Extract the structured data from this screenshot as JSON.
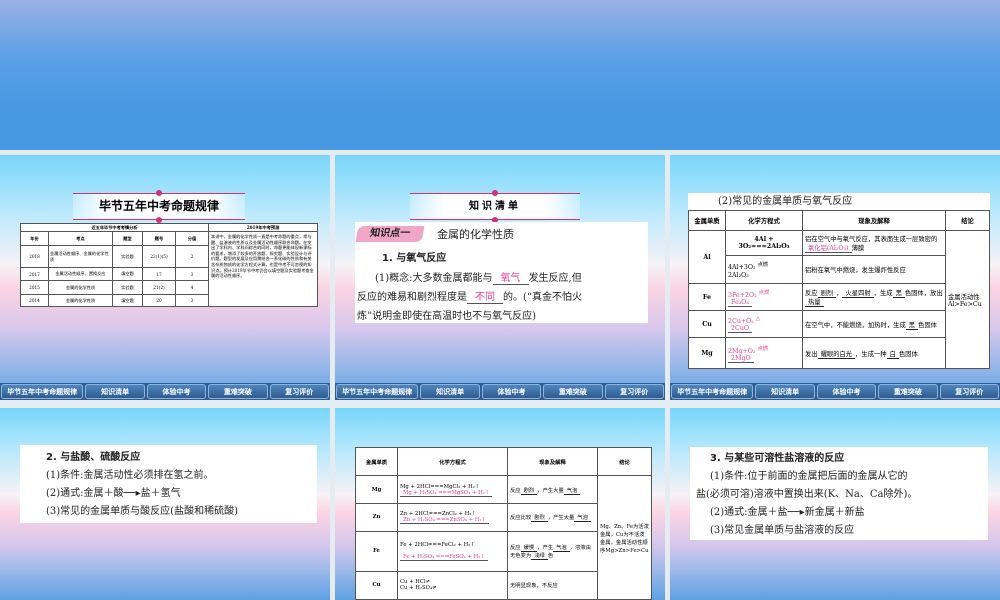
{
  "nav": [
    "毕节五年中考命题规律",
    "知识清单",
    "体验中考",
    "重难突破",
    "复习评价"
  ],
  "s1": {
    "title": "毕节五年中考命题规律",
    "table_title": "近五年毕节中考考情分析",
    "pred_title": "2019年中考预测",
    "headers": [
      "年份",
      "考点",
      "题型",
      "题号",
      "分值"
    ],
    "rows": [
      [
        "2018",
        "金属活动性顺序、金属的化学性质",
        "实验题",
        "22(1)(5)",
        "2"
      ],
      [
        "2017",
        "金属活动性顺序、置换反应",
        "填空题",
        "17",
        "3"
      ],
      [
        "2015",
        "金属的化学性质",
        "实验题",
        "21(2)",
        "4"
      ],
      [
        "2014",
        "金属的化学性质",
        "填空题",
        "20",
        "3"
      ]
    ],
    "prediction": "本讲中，金属的化学性质一直是中考命题的重点，常与酸、盐溶液的性质以及金属活动性顺序联合命题。在突出了学科内、学科间综合的同时，命题更能体现新课标的要求，增添了较多的开放题、探究题、实验设计与评价题。题型的发展及应用需结合一系化碳的性质和有关含杂质物质的化学方程式计算，也是中考不可忽视的知识点。预计2019毕节中考仍会以填空题及实验题考查金属的活动性顺序。"
  },
  "s2": {
    "title": "知识清单",
    "tag": "知识点一",
    "heading": "金属的化学性质",
    "sub": "1. 与氧气反应",
    "p1a": "(1)概念:大多数金属都能与",
    "blank1": "氧气",
    "p1b": "发生反应,但",
    "p2a": "反应的难易和剧烈程度是",
    "blank2": "不同",
    "p2b": "的。(“真金不怕火",
    "p3": "炼”说明金即使在高温时也不与氧气反应)"
  },
  "s3": {
    "title": "(2)常见的金属单质与氧气反应",
    "headers": [
      "金属单质",
      "化学方程式",
      "现象及解释",
      "结论"
    ],
    "al": "Al",
    "al_eq1": "4Al + 3O₂===2Al₂O₃",
    "al_ph1a": "铝在空气中与氧气反应，其表面生成一层致密的",
    "al_ph1_blank": "氧化铝(Al₂O₃)",
    "al_ph1b": "薄膜",
    "al_eq2a": "4Al+3O₂",
    "al_eq2_cond": "点燃",
    "al_eq2b": "2Al₂O₃",
    "al_ph2": "铝粉在氧气中燃烧，发生爆炸性反应",
    "fe": "Fe",
    "fe_eq_a": "3Fe+2O₂",
    "fe_cond": "点燃",
    "fe_eq_b": "Fe₃O₄",
    "fe_ph": [
      "反应",
      "剧烈",
      "，",
      "火星四射",
      "，生成",
      "黑",
      "色固体，放出",
      "热量"
    ],
    "cu": "Cu",
    "cu_eq_a": "2Cu+O₂",
    "cu_cond": "△",
    "cu_eq_b": "2CuO",
    "cu_ph": [
      "在空气中，不能燃烧，加热时，生成",
      "黑",
      "色固体"
    ],
    "mg": "Mg",
    "mg_eq_a": "2Mg+O₂",
    "mg_cond": "点燃",
    "mg_eq_b": "2MgO",
    "mg_ph": [
      "发出",
      "耀眼的白光",
      "，生成一种",
      "白",
      "色固体"
    ],
    "conclusion": "金属活动性 Al>Fe>Cu"
  },
  "s4": {
    "h": "2. 与盐酸、硫酸反应",
    "p1": "(1)条件:金属活动性必须排在氢之前。",
    "p2": "(2)通式:金属＋酸──▸盐＋氢气",
    "p3": "(3)常见的金属单质与酸反应(盐酸和稀硫酸)"
  },
  "s5": {
    "headers": [
      "金属单质",
      "化学方程式",
      "现象及解释",
      "结论"
    ],
    "rows": [
      {
        "m": "Mg",
        "eq1": "Mg + 2HCl===MgCl₂ + H₂↑",
        "eq2": "Mg + H₂SO₄ ===MgSO₄ + H₂↑",
        "ph": [
          "反应",
          "剧烈",
          "，产生大量",
          "气泡"
        ]
      },
      {
        "m": "Zn",
        "eq1": "Zn + 2HCl===ZnCl₂ + H₂↑",
        "eq2": "Zn + H₂SO₄ ===ZnSO₄ + H₂↑",
        "ph": [
          "反应比较",
          "剧烈",
          "，产生大量",
          "气泡"
        ]
      },
      {
        "m": "Fe",
        "eq1": "Fe + 2HCl===FeCl₂ + H₂↑",
        "eq2": "Fe + H₂SO₄ ===FeSO₄ + H₂↑",
        "ph": [
          "反应",
          "缓慢",
          "，产生",
          "气泡",
          "，溶液由无色变为",
          "浅绿",
          "色"
        ]
      },
      {
        "m": "Cu",
        "eq1": "Cu + HCl≠",
        "eq2": "Cu + H₂SO₄≠",
        "ph": [
          "无明显现象，不反应"
        ]
      }
    ],
    "conclusion": "Mg、Zn、Fe为活泼金属，Cu为不活泼金属，金属活动性顺序Mg>Zn>Fe>Cu"
  },
  "s6": {
    "h": "3. 与某些可溶性盐溶液的反应",
    "p1": "(1)条件:位于前面的金属把后面的金属从它的",
    "p2": "盐(必须可溶)溶液中置换出来(K、Na、Ca除外)。",
    "p3": "(2)通式:金属＋盐──▸新金属＋新盐",
    "p4": "(3)常见金属单质与盐溶液的反应"
  }
}
